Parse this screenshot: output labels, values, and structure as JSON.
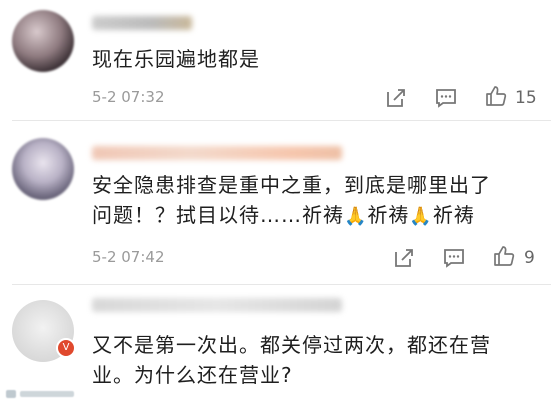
{
  "comments": [
    {
      "text": "现在乐园遍地都是",
      "time": "5-2 07:32",
      "likes": "15",
      "pray_count": 0
    },
    {
      "text_line1": "安全隐患排查是重中之重，到底是哪里出了",
      "text_line2_a": "问题！？拭目以待……祈祷",
      "text_line2_b": "祈祷",
      "text_line2_c": "祈祷",
      "pray_emoji": "🙏",
      "time": "5-2 07:42",
      "likes": "9"
    },
    {
      "text_line1": "又不是第一次出。都关停过两次，都还在营",
      "text_line2": "业。为什么还在营业?",
      "badge": "V"
    }
  ],
  "icons": {
    "share": "share-icon",
    "comment": "comment-icon",
    "like": "thumbs-up-icon"
  },
  "colors": {
    "time": "#9a9a9a",
    "text": "#1f1f1f",
    "badge": "#e0492d"
  }
}
